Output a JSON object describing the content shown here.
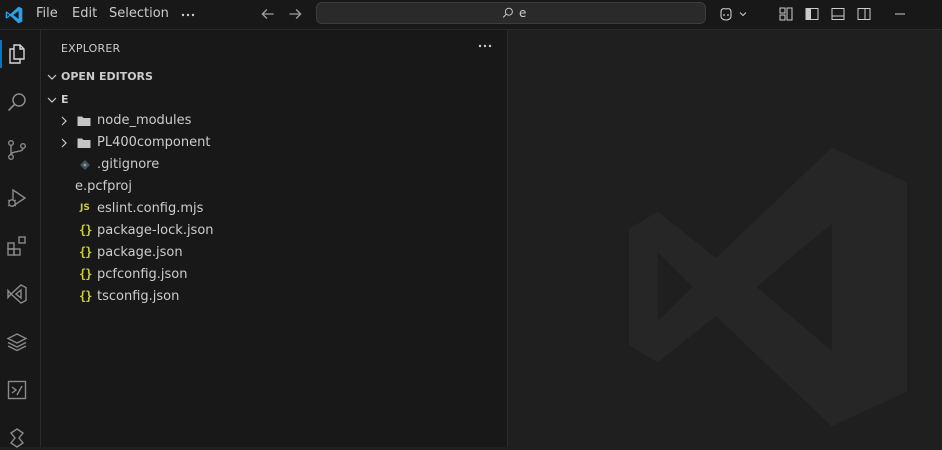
{
  "titlebar": {
    "menus": [
      "File",
      "Edit",
      "Selection"
    ],
    "overflow_icon": "more-horizontal-icon",
    "search_text": "e"
  },
  "sidebar": {
    "title": "EXPLORER",
    "open_editors_label": "OPEN EDITORS",
    "workspace_label": "E",
    "folders": [
      "node_modules",
      "PL400component"
    ],
    "files": [
      {
        "name": ".gitignore",
        "icon": "git-diamond-icon"
      },
      {
        "name": "e.pcfproj",
        "icon": "none"
      },
      {
        "name": "eslint.config.mjs",
        "icon": "js-icon",
        "badge": "JS"
      },
      {
        "name": "package-lock.json",
        "icon": "json-icon",
        "badge": "{}"
      },
      {
        "name": "package.json",
        "icon": "json-icon",
        "badge": "{}"
      },
      {
        "name": "pcfconfig.json",
        "icon": "json-icon",
        "badge": "{}"
      },
      {
        "name": "tsconfig.json",
        "icon": "json-icon",
        "badge": "{}"
      }
    ]
  },
  "colors": {
    "accent": "#0078d4",
    "json_badge": "#cbcb41",
    "folder": "#c5c5c5",
    "watermark": "#262626"
  }
}
